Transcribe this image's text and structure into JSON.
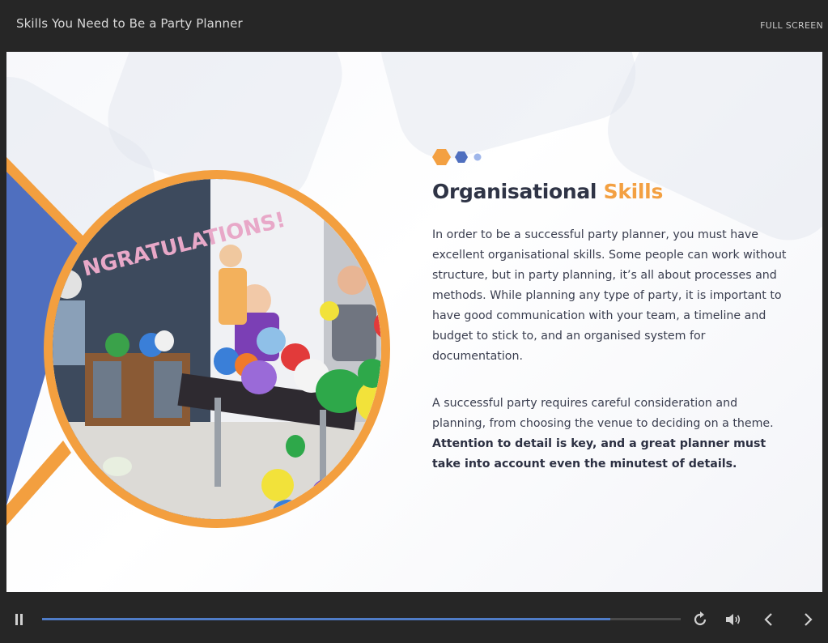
{
  "header": {
    "course_title": "Skills You Need to Be a Party Planner",
    "fullscreen_label": "FULL SCREEN"
  },
  "slide": {
    "heading_main": "Organisational",
    "heading_accent": "Skills",
    "paragraph1": "In order to be a successful party planner, you must have excellent organisational skills. Some people can work without structure, but in party planning, it’s all about processes and methods. While planning any type of party, it is important to have good communication with your team, a timeline and budget to stick to, and an organised system for documentation.",
    "paragraph2_regular": "A successful party requires careful consideration and planning, from choosing the venue to deciding on a theme. ",
    "paragraph2_bold": "Attention to detail is key, and a great planner must take into account even the minutest of details.",
    "banner_text": "NGRATULATIONS!",
    "colors": {
      "accent": "#f3a042",
      "blue": "#4f6fbf",
      "heading": "#2f3446"
    }
  },
  "player": {
    "progress": 0.89,
    "icons": [
      "pause-icon",
      "replay-icon",
      "volume-icon",
      "chevron-left-icon",
      "chevron-right-icon"
    ]
  }
}
